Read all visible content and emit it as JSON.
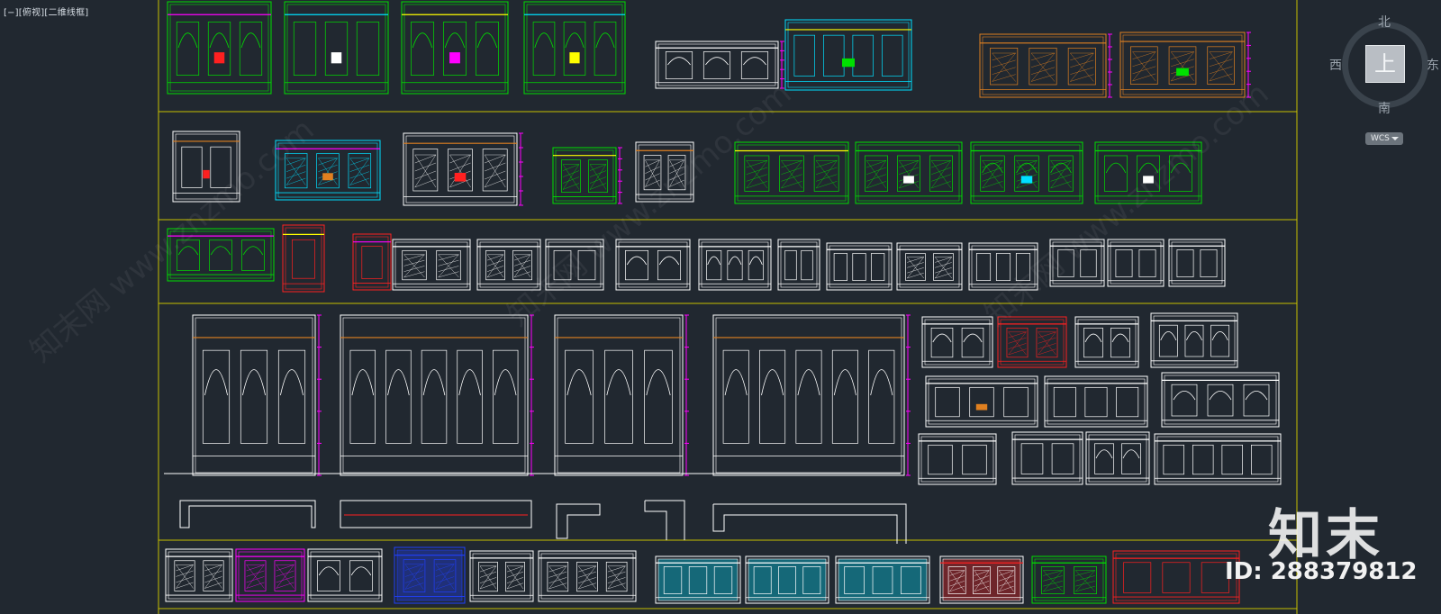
{
  "viewport": {
    "label": "[−][俯视][二维线框]"
  },
  "viewcube": {
    "top_label": "上",
    "north": "北",
    "south": "南",
    "west": "西",
    "east": "东",
    "wcs": "WCS"
  },
  "colors": {
    "background": "#212830",
    "frame": "#c8c000",
    "white": "#ffffff",
    "green": "#00e000",
    "red": "#ff2020",
    "magenta": "#ff00ff",
    "cyan": "#00e0ff",
    "yellow": "#ffff00",
    "orange": "#e08020",
    "blue": "#2040ff"
  },
  "watermark": {
    "logo": "知末",
    "id": "ID: 288379812",
    "diagonal": "知末网 www.znzmo.com"
  }
}
